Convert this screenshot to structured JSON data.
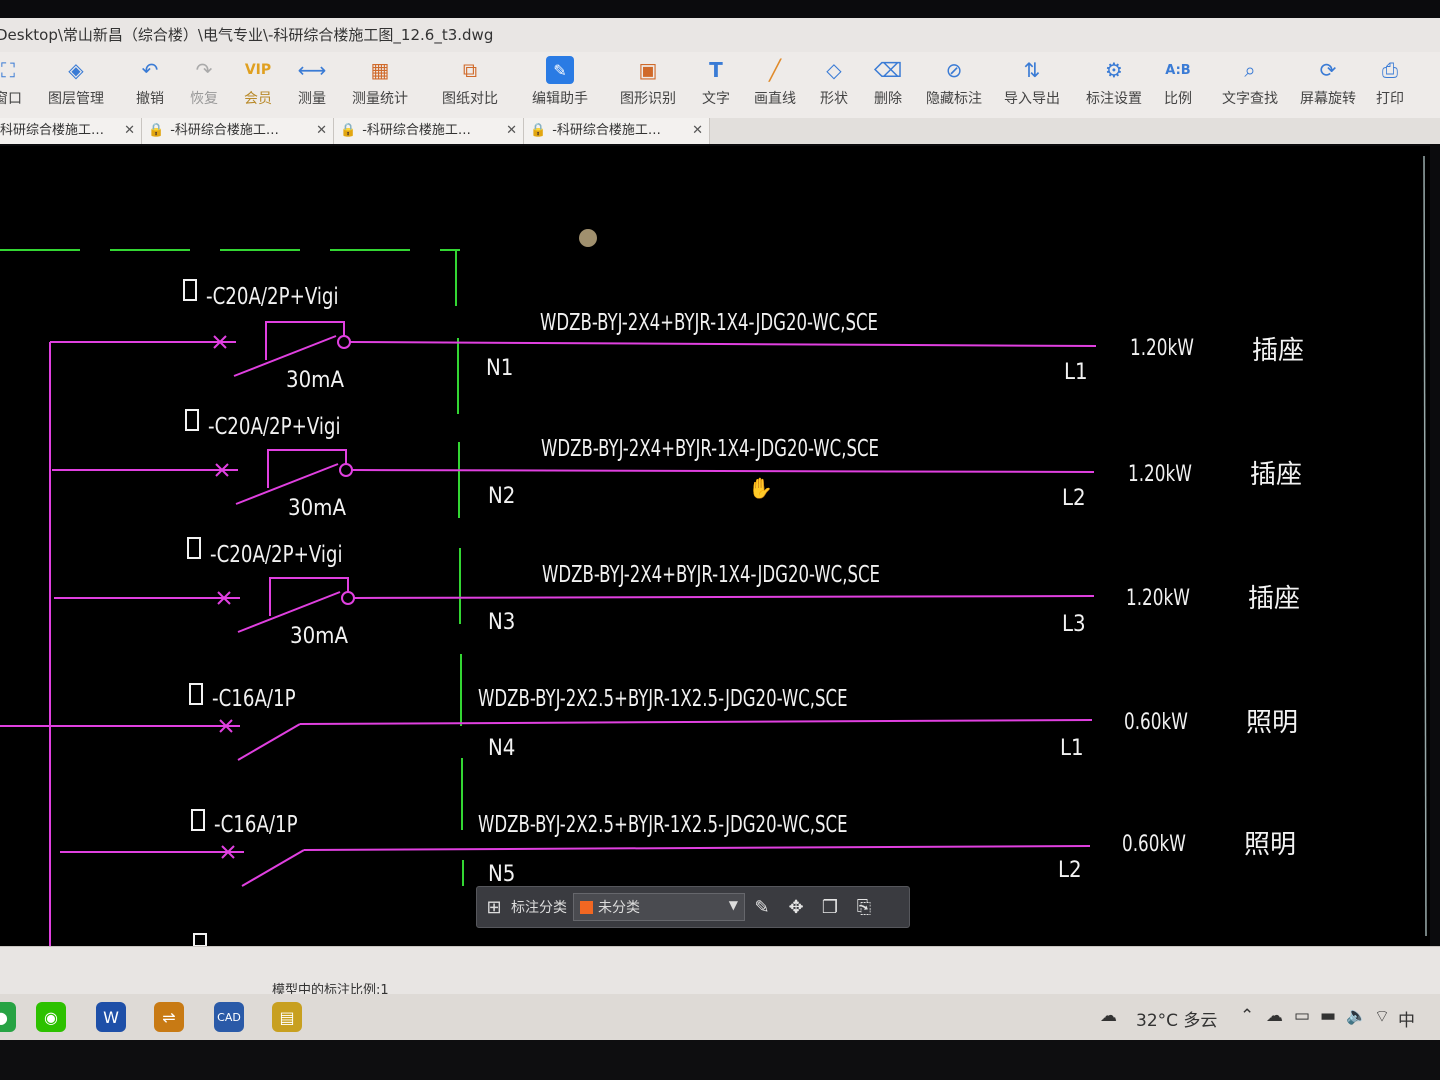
{
  "window": {
    "title": "Desktop\\常山新昌（综合楼）\\电气专业\\-科研综合楼施工图_12.6_t3.dwg"
  },
  "toolbar": [
    {
      "label": "窗口",
      "icon": "window-icon"
    },
    {
      "label": "图层管理",
      "icon": "layers-icon"
    },
    {
      "label": "撤销",
      "icon": "undo-icon"
    },
    {
      "label": "恢复",
      "icon": "redo-icon"
    },
    {
      "label": "会员",
      "icon": "vip-icon"
    },
    {
      "label": "测量",
      "icon": "measure-icon"
    },
    {
      "label": "测量统计",
      "icon": "measure-stats-icon"
    },
    {
      "label": "图纸对比",
      "icon": "compare-icon"
    },
    {
      "label": "编辑助手",
      "icon": "edit-assistant-icon"
    },
    {
      "label": "图形识别",
      "icon": "shape-recognition-icon"
    },
    {
      "label": "文字",
      "icon": "text-icon"
    },
    {
      "label": "画直线",
      "icon": "line-icon"
    },
    {
      "label": "形状",
      "icon": "shape-icon"
    },
    {
      "label": "删除",
      "icon": "eraser-icon"
    },
    {
      "label": "隐藏标注",
      "icon": "hide-annotation-icon"
    },
    {
      "label": "导入导出",
      "icon": "import-export-icon"
    },
    {
      "label": "标注设置",
      "icon": "annotation-settings-icon"
    },
    {
      "label": "比例",
      "icon": "scale-icon"
    },
    {
      "label": "文字查找",
      "icon": "text-search-icon"
    },
    {
      "label": "屏幕旋转",
      "icon": "rotate-screen-icon"
    },
    {
      "label": "打印",
      "icon": "print-icon"
    }
  ],
  "tabs": [
    {
      "label": "科研综合楼施工…",
      "locked": false
    },
    {
      "label": "-科研综合楼施工…",
      "locked": true
    },
    {
      "label": "-科研综合楼施工…",
      "locked": true
    },
    {
      "label": "-科研综合楼施工…",
      "locked": true
    }
  ],
  "circuits": [
    {
      "breaker": "-C20A/2P+Vigi",
      "rcd": "30mA",
      "cable": "WDZB-BYJ-2X4+BYJR-1X4-JDG20-WC,SCE",
      "circuit": "N1",
      "phase": "L1",
      "power": "1.20kW",
      "load": "插座"
    },
    {
      "breaker": "-C20A/2P+Vigi",
      "rcd": "30mA",
      "cable": "WDZB-BYJ-2X4+BYJR-1X4-JDG20-WC,SCE",
      "circuit": "N2",
      "phase": "L2",
      "power": "1.20kW",
      "load": "插座"
    },
    {
      "breaker": "-C20A/2P+Vigi",
      "rcd": "30mA",
      "cable": "WDZB-BYJ-2X4+BYJR-1X4-JDG20-WC,SCE",
      "circuit": "N3",
      "phase": "L3",
      "power": "1.20kW",
      "load": "插座"
    },
    {
      "breaker": "-C16A/1P",
      "rcd": "",
      "cable": "WDZB-BYJ-2X2.5+BYJR-1X2.5-JDG20-WC,SCE",
      "circuit": "N4",
      "phase": "L1",
      "power": "0.60kW",
      "load": "照明"
    },
    {
      "breaker": "-C16A/1P",
      "rcd": "",
      "cable": "WDZB-BYJ-2X2.5+BYJR-1X2.5-JDG20-WC,SCE",
      "circuit": "N5",
      "phase": "L2",
      "power": "0.60kW",
      "load": "照明"
    }
  ],
  "annotation_bar": {
    "label": "标注分类",
    "selected": "未分类",
    "swatch_color": "#f26722"
  },
  "status": {
    "text": "模型中的标注比例:1"
  },
  "tray": {
    "weather": "32°C 多云",
    "ime": "中"
  },
  "colors": {
    "wire": "#e040e0",
    "busbar": "#33d633",
    "text": "#f2f2f2"
  }
}
